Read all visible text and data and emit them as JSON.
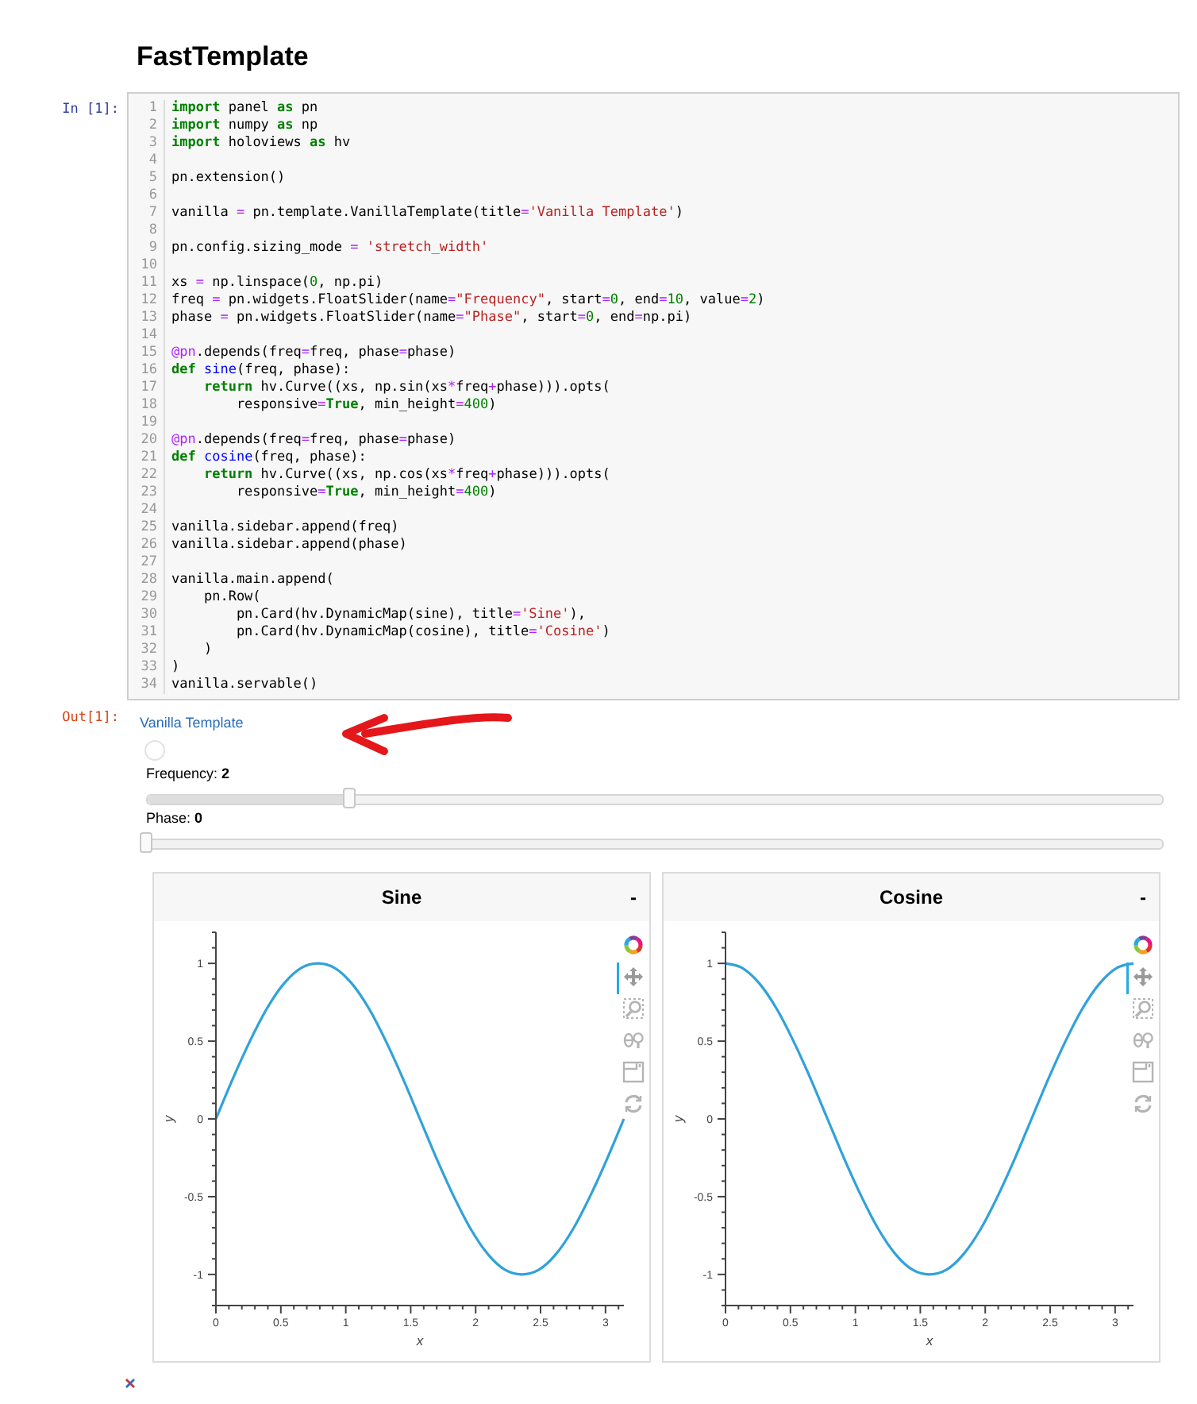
{
  "title": "FastTemplate",
  "input_cell": {
    "prompt": "In [1]:",
    "lines": [
      {
        "number": "1",
        "tokens": [
          {
            "kind": "kw",
            "text": "import"
          },
          {
            "kind": "plain",
            "text": " panel "
          },
          {
            "kind": "kw",
            "text": "as"
          },
          {
            "kind": "plain",
            "text": " pn"
          }
        ]
      },
      {
        "number": "2",
        "tokens": [
          {
            "kind": "kw",
            "text": "import"
          },
          {
            "kind": "plain",
            "text": " numpy "
          },
          {
            "kind": "kw",
            "text": "as"
          },
          {
            "kind": "plain",
            "text": " np"
          }
        ]
      },
      {
        "number": "3",
        "tokens": [
          {
            "kind": "kw",
            "text": "import"
          },
          {
            "kind": "plain",
            "text": " holoviews "
          },
          {
            "kind": "kw",
            "text": "as"
          },
          {
            "kind": "plain",
            "text": " hv"
          }
        ]
      },
      {
        "number": "4"
      },
      {
        "number": "5",
        "tokens": [
          {
            "kind": "plain",
            "text": "pn.extension()"
          }
        ]
      },
      {
        "number": "6"
      },
      {
        "number": "7",
        "tokens": [
          {
            "kind": "plain",
            "text": "vanilla "
          },
          {
            "kind": "op",
            "text": "="
          },
          {
            "kind": "plain",
            "text": " pn.template.VanillaTemplate(title"
          },
          {
            "kind": "op",
            "text": "="
          },
          {
            "kind": "str",
            "text": "'Vanilla Template'"
          },
          {
            "kind": "plain",
            "text": ")"
          }
        ]
      },
      {
        "number": "8"
      },
      {
        "number": "9",
        "tokens": [
          {
            "kind": "plain",
            "text": "pn.config.sizing_mode "
          },
          {
            "kind": "op",
            "text": "="
          },
          {
            "kind": "str",
            "text": " 'stretch_width'"
          }
        ]
      },
      {
        "number": "10"
      },
      {
        "number": "11",
        "tokens": [
          {
            "kind": "plain",
            "text": "xs "
          },
          {
            "kind": "op",
            "text": "="
          },
          {
            "kind": "plain",
            "text": " np.linspace("
          },
          {
            "kind": "num",
            "text": "0"
          },
          {
            "kind": "plain",
            "text": ", np.pi)"
          }
        ]
      },
      {
        "number": "12",
        "tokens": [
          {
            "kind": "plain",
            "text": "freq "
          },
          {
            "kind": "op",
            "text": "="
          },
          {
            "kind": "plain",
            "text": " pn.widgets.FloatSlider(name"
          },
          {
            "kind": "op",
            "text": "="
          },
          {
            "kind": "str",
            "text": "\"Frequency\""
          },
          {
            "kind": "plain",
            "text": ", start"
          },
          {
            "kind": "op",
            "text": "="
          },
          {
            "kind": "num",
            "text": "0"
          },
          {
            "kind": "plain",
            "text": ", end"
          },
          {
            "kind": "op",
            "text": "="
          },
          {
            "kind": "num",
            "text": "10"
          },
          {
            "kind": "plain",
            "text": ", value"
          },
          {
            "kind": "op",
            "text": "="
          },
          {
            "kind": "num",
            "text": "2"
          },
          {
            "kind": "plain",
            "text": ")"
          }
        ]
      },
      {
        "number": "13",
        "tokens": [
          {
            "kind": "plain",
            "text": "phase "
          },
          {
            "kind": "op",
            "text": "="
          },
          {
            "kind": "plain",
            "text": " pn.widgets.FloatSlider(name"
          },
          {
            "kind": "op",
            "text": "="
          },
          {
            "kind": "str",
            "text": "\"Phase\""
          },
          {
            "kind": "plain",
            "text": ", start"
          },
          {
            "kind": "op",
            "text": "="
          },
          {
            "kind": "num",
            "text": "0"
          },
          {
            "kind": "plain",
            "text": ", end"
          },
          {
            "kind": "op",
            "text": "="
          },
          {
            "kind": "plain",
            "text": "np.pi)"
          }
        ]
      },
      {
        "number": "14"
      },
      {
        "number": "15",
        "tokens": [
          {
            "kind": "deco",
            "text": "@pn"
          },
          {
            "kind": "plain",
            "text": ".depends(freq"
          },
          {
            "kind": "op",
            "text": "="
          },
          {
            "kind": "plain",
            "text": "freq, phase"
          },
          {
            "kind": "op",
            "text": "="
          },
          {
            "kind": "plain",
            "text": "phase)"
          }
        ]
      },
      {
        "number": "16",
        "tokens": [
          {
            "kind": "kw",
            "text": "def"
          },
          {
            "kind": "fn",
            "text": " sine"
          },
          {
            "kind": "plain",
            "text": "(freq, phase):"
          }
        ]
      },
      {
        "number": "17",
        "tokens": [
          {
            "kind": "kw",
            "text": "    return"
          },
          {
            "kind": "plain",
            "text": " hv.Curve((xs, np.sin(xs"
          },
          {
            "kind": "op",
            "text": "*"
          },
          {
            "kind": "plain",
            "text": "freq"
          },
          {
            "kind": "op",
            "text": "+"
          },
          {
            "kind": "plain",
            "text": "phase))).opts("
          }
        ]
      },
      {
        "number": "18",
        "tokens": [
          {
            "kind": "plain",
            "text": "        responsive"
          },
          {
            "kind": "op",
            "text": "="
          },
          {
            "kind": "kw",
            "text": "True"
          },
          {
            "kind": "plain",
            "text": ", min_height"
          },
          {
            "kind": "op",
            "text": "="
          },
          {
            "kind": "num",
            "text": "400"
          },
          {
            "kind": "plain",
            "text": ")"
          }
        ]
      },
      {
        "number": "19"
      },
      {
        "number": "20",
        "tokens": [
          {
            "kind": "deco",
            "text": "@pn"
          },
          {
            "kind": "plain",
            "text": ".depends(freq"
          },
          {
            "kind": "op",
            "text": "="
          },
          {
            "kind": "plain",
            "text": "freq, phase"
          },
          {
            "kind": "op",
            "text": "="
          },
          {
            "kind": "plain",
            "text": "phase)"
          }
        ]
      },
      {
        "number": "21",
        "tokens": [
          {
            "kind": "kw",
            "text": "def"
          },
          {
            "kind": "fn",
            "text": " cosine"
          },
          {
            "kind": "plain",
            "text": "(freq, phase):"
          }
        ]
      },
      {
        "number": "22",
        "tokens": [
          {
            "kind": "kw",
            "text": "    return"
          },
          {
            "kind": "plain",
            "text": " hv.Curve((xs, np.cos(xs"
          },
          {
            "kind": "op",
            "text": "*"
          },
          {
            "kind": "plain",
            "text": "freq"
          },
          {
            "kind": "op",
            "text": "+"
          },
          {
            "kind": "plain",
            "text": "phase))).opts("
          }
        ]
      },
      {
        "number": "23",
        "tokens": [
          {
            "kind": "plain",
            "text": "        responsive"
          },
          {
            "kind": "op",
            "text": "="
          },
          {
            "kind": "kw",
            "text": "True"
          },
          {
            "kind": "plain",
            "text": ", min_height"
          },
          {
            "kind": "op",
            "text": "="
          },
          {
            "kind": "num",
            "text": "400"
          },
          {
            "kind": "plain",
            "text": ")"
          }
        ]
      },
      {
        "number": "24"
      },
      {
        "number": "25",
        "tokens": [
          {
            "kind": "plain",
            "text": "vanilla.sidebar.append(freq)"
          }
        ]
      },
      {
        "number": "26",
        "tokens": [
          {
            "kind": "plain",
            "text": "vanilla.sidebar.append(phase)"
          }
        ]
      },
      {
        "number": "27"
      },
      {
        "number": "28",
        "tokens": [
          {
            "kind": "plain",
            "text": "vanilla.main.append("
          }
        ]
      },
      {
        "number": "29",
        "tokens": [
          {
            "kind": "plain",
            "text": "    pn.Row("
          }
        ]
      },
      {
        "number": "30",
        "tokens": [
          {
            "kind": "plain",
            "text": "        pn.Card(hv.DynamicMap(sine), title"
          },
          {
            "kind": "op",
            "text": "="
          },
          {
            "kind": "str",
            "text": "'Sine'"
          },
          {
            "kind": "plain",
            "text": "),"
          }
        ]
      },
      {
        "number": "31",
        "tokens": [
          {
            "kind": "plain",
            "text": "        pn.Card(hv.DynamicMap(cosine), title"
          },
          {
            "kind": "op",
            "text": "="
          },
          {
            "kind": "str",
            "text": "'Cosine'"
          },
          {
            "kind": "plain",
            "text": ")"
          }
        ]
      },
      {
        "number": "32",
        "tokens": [
          {
            "kind": "plain",
            "text": "    )"
          }
        ]
      },
      {
        "number": "33",
        "tokens": [
          {
            "kind": "plain",
            "text": ")"
          }
        ]
      },
      {
        "number": "34",
        "tokens": [
          {
            "kind": "plain",
            "text": "vanilla.servable()"
          }
        ]
      }
    ]
  },
  "output_cell": {
    "prompt": "Out[1]:",
    "link": "Vanilla Template",
    "sliders": [
      {
        "label": "Frequency: **2**",
        "level": 0.2
      },
      {
        "label": "Phase: **0**",
        "level": 0
      }
    ],
    "cards": [
      {
        "title": "Sine",
        "collapse": "-",
        "tools": [
          {
            "kind": "pan",
            "active": true
          },
          {
            "kind": "box_zoom",
            "active": false
          },
          {
            "kind": "wheel_zoom",
            "active": false
          },
          {
            "kind": "save",
            "active": false
          },
          {
            "kind": "reset",
            "active": false
          }
        ],
        "chart_data": {
          "type": "line",
          "xlabel": "x",
          "ylabel": "y",
          "xlim": [
            0,
            3.1416
          ],
          "ylim": [
            -1.2,
            1.2
          ],
          "xticks": [
            0,
            0.5,
            1,
            1.5,
            2,
            2.5,
            3
          ],
          "yticks": [
            -1,
            -0.5,
            0,
            0.5,
            1
          ],
          "x": [
            0,
            0.1309,
            0.2618,
            0.3927,
            0.5236,
            0.6545,
            0.7854,
            0.9163,
            1.0472,
            1.1781,
            1.309,
            1.4399,
            1.5708,
            1.7017,
            1.8326,
            1.9635,
            2.0944,
            2.2253,
            2.3562,
            2.4871,
            2.618,
            2.7489,
            2.8798,
            3.0107,
            3.1416
          ],
          "series": [
            {
              "color": "#30a2da",
              "values": [
                0,
                0.26,
                0.5,
                0.71,
                0.87,
                0.97,
                1,
                0.97,
                0.87,
                0.71,
                0.5,
                0.26,
                0,
                -0.26,
                -0.5,
                -0.71,
                -0.87,
                -0.97,
                -1,
                -0.97,
                -0.87,
                -0.71,
                -0.5,
                -0.26,
                0
              ]
            }
          ]
        }
      },
      {
        "title": "Cosine",
        "collapse": "-",
        "tools": [
          {
            "kind": "pan",
            "active": true
          },
          {
            "kind": "box_zoom",
            "active": false
          },
          {
            "kind": "wheel_zoom",
            "active": false
          },
          {
            "kind": "save",
            "active": false
          },
          {
            "kind": "reset",
            "active": false
          }
        ],
        "chart_data": {
          "type": "line",
          "xlabel": "x",
          "ylabel": "y",
          "xlim": [
            0,
            3.1416
          ],
          "ylim": [
            -1.2,
            1.2
          ],
          "xticks": [
            0,
            0.5,
            1,
            1.5,
            2,
            2.5,
            3
          ],
          "yticks": [
            -1,
            -0.5,
            0,
            0.5,
            1
          ],
          "x": [
            0,
            0.1309,
            0.2618,
            0.3927,
            0.5236,
            0.6545,
            0.7854,
            0.9163,
            1.0472,
            1.1781,
            1.309,
            1.4399,
            1.5708,
            1.7017,
            1.8326,
            1.9635,
            2.0944,
            2.2253,
            2.3562,
            2.4871,
            2.618,
            2.7489,
            2.8798,
            3.0107,
            3.1416
          ],
          "series": [
            {
              "color": "#30a2da",
              "values": [
                1,
                0.97,
                0.87,
                0.71,
                0.5,
                0.26,
                0,
                -0.26,
                -0.5,
                -0.71,
                -0.87,
                -0.97,
                -1,
                -0.97,
                -0.87,
                -0.71,
                -0.5,
                -0.26,
                0,
                0.26,
                0.5,
                0.71,
                0.87,
                0.97,
                1
              ]
            }
          ]
        }
      }
    ]
  }
}
